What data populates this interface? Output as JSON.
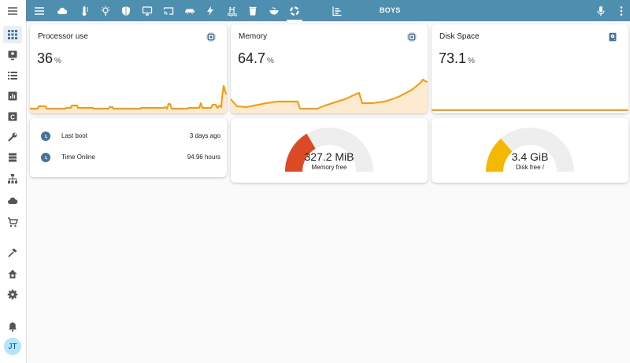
{
  "sidebar": {
    "items": [
      {
        "name": "menu-icon"
      },
      {
        "name": "overview-icon"
      },
      {
        "name": "map-icon"
      },
      {
        "name": "logbook-icon"
      },
      {
        "name": "history-icon"
      },
      {
        "name": "hacs-icon"
      },
      {
        "name": "tools-icon"
      },
      {
        "name": "storage-icon"
      },
      {
        "name": "network-icon"
      },
      {
        "name": "cloud-icon"
      },
      {
        "name": "cart-icon"
      },
      {
        "name": "hammer-icon"
      },
      {
        "name": "home-settings-icon"
      },
      {
        "name": "settings-icon"
      },
      {
        "name": "bell-icon"
      }
    ],
    "avatar": "JT"
  },
  "topbar": {
    "title": "BOYS",
    "tabs": [
      {
        "name": "weather-icon"
      },
      {
        "name": "thermometer-icon"
      },
      {
        "name": "lightbulb-icon"
      },
      {
        "name": "shield-icon"
      },
      {
        "name": "monitor-icon"
      },
      {
        "name": "cast-icon"
      },
      {
        "name": "car-icon"
      },
      {
        "name": "power-icon"
      },
      {
        "name": "pool-icon"
      },
      {
        "name": "trash-icon"
      },
      {
        "name": "bowl-icon"
      },
      {
        "name": "system-monitor-icon"
      },
      {
        "name": "chart-box-icon"
      }
    ]
  },
  "cards": {
    "processor": {
      "title": "Processor use",
      "value": "36",
      "unit": "%"
    },
    "memory": {
      "title": "Memory",
      "value": "64.7",
      "unit": "%"
    },
    "disk": {
      "title": "Disk Space",
      "value": "73.1",
      "unit": "%"
    },
    "uptime": {
      "rows": [
        {
          "label": "Last boot",
          "value": "3 days ago"
        },
        {
          "label": "Time Online",
          "value": "94.96 hours"
        }
      ]
    },
    "memory_gauge": {
      "value": "327.2 MiB",
      "label": "Memory free",
      "level": 0.33,
      "color": "#db4a24"
    },
    "disk_gauge": {
      "value": "3.4 GiB",
      "label": "Disk free /",
      "level": 0.27,
      "color": "#f5b800"
    }
  },
  "colors": {
    "accent": "#4e8fb0",
    "graph": "#ff9800",
    "graph_fill": "#fdebd1",
    "track": "#eeeeee"
  }
}
